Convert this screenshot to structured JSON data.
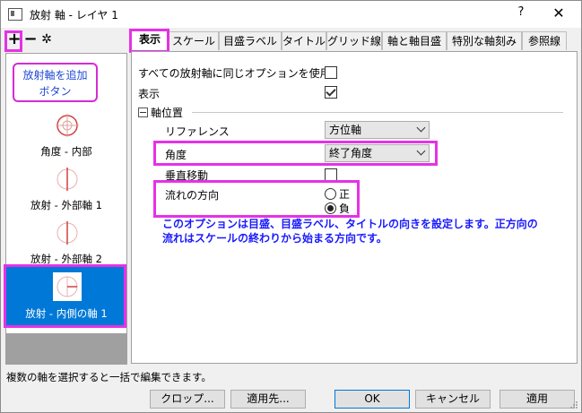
{
  "window": {
    "title": "放射 軸 - レイヤ 1",
    "help": "?",
    "close": "✕"
  },
  "toolbar": {
    "add": "+",
    "remove": "−",
    "settings": "✲"
  },
  "tooltip": {
    "line1": "放射軸を追加",
    "line2": "ボタン"
  },
  "axes": [
    {
      "label": "角度 - 内部",
      "selected": false
    },
    {
      "label": "放射 - 外部軸 1",
      "selected": false
    },
    {
      "label": "放射 - 外部軸 2",
      "selected": false
    },
    {
      "label": "放射 - 内側の軸 1",
      "selected": true
    }
  ],
  "tabs": [
    "表示",
    "スケール",
    "目盛ラベル",
    "タイトル",
    "グリッド線",
    "軸と軸目盛",
    "特別な軸刻み",
    "参照線"
  ],
  "active_tab": "表示",
  "panel": {
    "same_option_label": "すべての放射軸に同じオプションを使用",
    "same_option_checked": false,
    "show_label": "表示",
    "show_checked": true,
    "group_label": "軸位置",
    "reference_label": "リファレンス",
    "reference_value": "方位軸",
    "angle_label": "角度",
    "angle_value": "終了角度",
    "vertical_move_label": "垂直移動",
    "vertical_move_checked": false,
    "flow_label": "流れの方向",
    "flow_pos": "正",
    "flow_neg": "負",
    "flow_selected": "負",
    "description_line1": "このオプションは目盛、目盛ラベル、タイトルの向きを設定します。正方向の",
    "description_line2": "流れはスケールの終わりから始まる方向です。"
  },
  "status": "複数の軸を選択すると一括で編集できます。",
  "buttons": {
    "crop": "クロップ...",
    "apply_to": "適用先...",
    "ok": "OK",
    "cancel": "キャンセル",
    "apply": "適用"
  },
  "colors": {
    "highlight": "#e631e6",
    "selected": "#0078d7",
    "description": "#1a1aff",
    "tooltip_text": "#1f49d6"
  }
}
